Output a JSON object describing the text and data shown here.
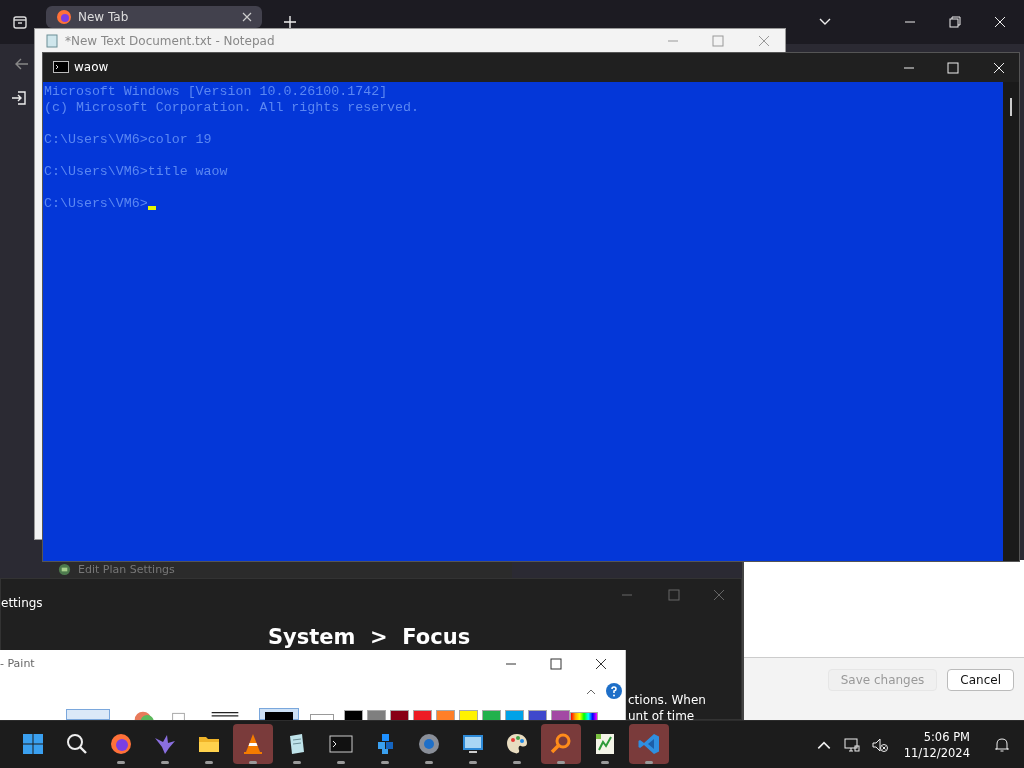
{
  "browser": {
    "tabs": [
      {
        "label": "New Tab",
        "selected": true
      }
    ]
  },
  "notepad": {
    "title": "*New Text Document.txt - Notepad"
  },
  "plan_window": {
    "title": "Edit Plan Settings"
  },
  "settings": {
    "title": "ettings",
    "heading": "System  >  Focus",
    "body_lines": [
      "ctions. When",
      "unt of time"
    ]
  },
  "dialog": {
    "buttons": [
      {
        "label": "Save changes",
        "disabled": true
      },
      {
        "label": "Cancel",
        "disabled": false
      }
    ]
  },
  "paint": {
    "title": "- Paint",
    "palette": [
      {
        "color": "#000000"
      },
      {
        "color": "#7f7f7f"
      },
      {
        "color": "#880015"
      },
      {
        "color": "#ed1c24"
      },
      {
        "color": "#ff7f27"
      },
      {
        "color": "#fff200"
      },
      {
        "color": "#22b14c"
      },
      {
        "color": "#00a2e8"
      },
      {
        "color": "#3f48cc"
      },
      {
        "color": "#a349a4"
      }
    ]
  },
  "console": {
    "title": "waow",
    "blocks": [
      [
        "Microsoft Windows [Version 10.0.26100.1742]",
        "(c) Microsoft Corporation. All rights reserved."
      ],
      [
        "C:\\Users\\VM6>color 19"
      ],
      [
        "C:\\Users\\VM6>title waow"
      ],
      [
        "C:\\Users\\VM6>"
      ]
    ]
  },
  "taskbar": {
    "apps": [
      {
        "kind": "start",
        "running": false,
        "flashing": false
      },
      {
        "kind": "search",
        "running": false,
        "flashing": false
      },
      {
        "kind": "firefox",
        "running": true,
        "flashing": false
      },
      {
        "kind": "bird",
        "running": true,
        "flashing": false
      },
      {
        "kind": "folder",
        "running": true,
        "flashing": false
      },
      {
        "kind": "cone",
        "running": true,
        "flashing": true
      },
      {
        "kind": "notepad",
        "running": true,
        "flashing": false
      },
      {
        "kind": "terminal",
        "running": true,
        "flashing": false
      },
      {
        "kind": "cubes",
        "running": true,
        "flashing": false
      },
      {
        "kind": "gear",
        "running": true,
        "flashing": false
      },
      {
        "kind": "monitor",
        "running": true,
        "flashing": false
      },
      {
        "kind": "palette",
        "running": true,
        "flashing": false
      },
      {
        "kind": "magnifier",
        "running": true,
        "flashing": true
      },
      {
        "kind": "chart",
        "running": true,
        "flashing": false
      },
      {
        "kind": "code",
        "running": true,
        "flashing": true
      }
    ],
    "clock": {
      "time": "5:06 PM",
      "date": "11/12/2024"
    }
  }
}
